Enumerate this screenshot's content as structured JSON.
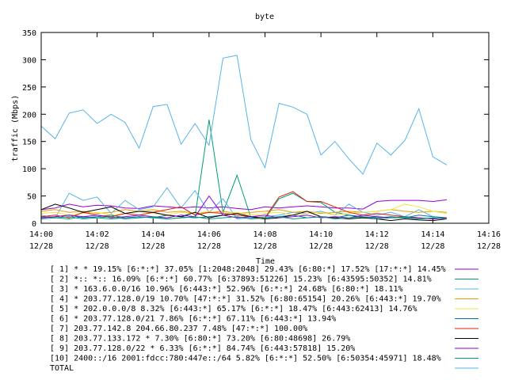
{
  "chart_data": {
    "type": "line",
    "title": "byte",
    "xlabel": "Time",
    "ylabel": "traffic (Mbps)",
    "ylim": [
      0,
      350
    ],
    "yticks": [
      "0",
      "50",
      "100",
      "150",
      "200",
      "250",
      "300",
      "350"
    ],
    "xlim": [
      "12/28 14:00",
      "12/28 14:16"
    ],
    "xticks": [
      {
        "time": "14:00",
        "date": "12/28"
      },
      {
        "time": "14:02",
        "date": "12/28"
      },
      {
        "time": "14:04",
        "date": "12/28"
      },
      {
        "time": "14:06",
        "date": "12/28"
      },
      {
        "time": "14:08",
        "date": "12/28"
      },
      {
        "time": "14:10",
        "date": "12/28"
      },
      {
        "time": "14:12",
        "date": "12/28"
      },
      {
        "time": "14:14",
        "date": "12/28"
      },
      {
        "time": "14:16",
        "date": "12/28"
      }
    ],
    "x_minutes": [
      0,
      0.5,
      1,
      1.5,
      2,
      2.5,
      3,
      3.5,
      4,
      4.5,
      5,
      5.5,
      6,
      6.5,
      7,
      7.5,
      8,
      8.5,
      9,
      9.5,
      10,
      10.5,
      11,
      11.5,
      12,
      12.5,
      13,
      13.5,
      14,
      14.5
    ],
    "grid": false,
    "legend_position": "bottom",
    "series": [
      {
        "legend": "[ 1] * * 19.15%  [6:*:*] 37.05% [1:2048:2048] 29.43% [6:80:*] 17.52% [17:*:*] 14.45%",
        "color": "#9400d3",
        "values": [
          25,
          28,
          35,
          30,
          33,
          32,
          28,
          27,
          32,
          30,
          28,
          30,
          28,
          30,
          27,
          25,
          30,
          28,
          30,
          32,
          30,
          28,
          28,
          26,
          40,
          42,
          42,
          42,
          40,
          43
        ]
      },
      {
        "legend": "[ 2] *:: *:: 16.09%  [6:*:*] 60.77% [6:37893:51226] 15.23% [6:43595:50352] 14.81%",
        "color": "#009e73",
        "values": [
          12,
          10,
          8,
          12,
          10,
          8,
          10,
          12,
          10,
          8,
          10,
          12,
          190,
          20,
          88,
          10,
          8,
          45,
          55,
          40,
          38,
          20,
          15,
          10,
          12,
          10,
          10,
          8,
          9,
          10
        ]
      },
      {
        "legend": "[ 3] * 163.6.0.0/16 10.96%  [6:443:*] 52.96% [6:*:*] 24.68% [6:80:*] 18.11%",
        "color": "#56b4e9",
        "values": [
          15,
          10,
          55,
          42,
          48,
          18,
          42,
          25,
          30,
          65,
          28,
          60,
          20,
          45,
          8,
          10,
          12,
          15,
          20,
          18,
          22,
          15,
          35,
          20,
          15,
          20,
          12,
          25,
          12,
          10
        ]
      },
      {
        "legend": "[ 4] * 203.77.128.0/19 10.70%  [47:*:*] 31.52% [6:80:65154] 20.26% [6:443:*] 19.70%",
        "color": "#e69f00",
        "values": [
          22,
          25,
          20,
          22,
          18,
          20,
          25,
          22,
          25,
          20,
          22,
          18,
          20,
          22,
          18,
          20,
          22,
          25,
          20,
          22,
          18,
          20,
          22,
          20,
          22,
          25,
          22,
          20,
          22,
          20
        ]
      },
      {
        "legend": "[ 5] * 202.0.0.0/8 8.32%  [6:443:*] 65.17% [6:*:*] 18.47% [6:443:62413] 14.76%",
        "color": "#f0e442",
        "values": [
          18,
          20,
          15,
          18,
          20,
          15,
          18,
          22,
          18,
          15,
          20,
          18,
          22,
          18,
          20,
          15,
          18,
          20,
          15,
          18,
          20,
          15,
          18,
          20,
          22,
          25,
          35,
          30,
          22,
          18
        ]
      },
      {
        "legend": "[ 6] * 203.77.128.0/21 7.86%  [6:*:*] 67.11% [6:443:*] 13.94%",
        "color": "#0072b2",
        "values": [
          10,
          12,
          15,
          10,
          12,
          15,
          10,
          12,
          10,
          15,
          12,
          10,
          12,
          15,
          10,
          12,
          10,
          12,
          15,
          10,
          12,
          10,
          15,
          12,
          10,
          12,
          10,
          15,
          12,
          10
        ]
      },
      {
        "legend": "[ 7] 203.77.142.8 204.66.80.237 7.48%  [47:*:*] 100.00%",
        "color": "#e51e10",
        "values": [
          12,
          15,
          10,
          20,
          15,
          12,
          18,
          15,
          20,
          25,
          30,
          15,
          20,
          18,
          15,
          12,
          10,
          48,
          58,
          40,
          40,
          30,
          20,
          15,
          18,
          15,
          12,
          10,
          8,
          10
        ]
      },
      {
        "legend": "[ 8] 203.77.133.172 * 7.30%  [6:80:*] 73.20% [6:80:48698] 26.79%",
        "color": "#000000",
        "values": [
          25,
          35,
          28,
          20,
          25,
          30,
          18,
          22,
          20,
          15,
          12,
          20,
          10,
          15,
          18,
          12,
          8,
          10,
          15,
          22,
          12,
          10,
          8,
          10,
          8,
          5,
          8,
          6,
          5,
          8
        ]
      },
      {
        "legend": "[ 9] 203.77.128.0/22 * 6.33%  [6:*:*] 84.74% [6:443:57818] 15.20%",
        "color": "#9400d3",
        "values": [
          10,
          12,
          15,
          12,
          15,
          10,
          12,
          15,
          12,
          10,
          15,
          12,
          50,
          15,
          10,
          12,
          15,
          10,
          12,
          15,
          10,
          12,
          10,
          15,
          12,
          10,
          12,
          10,
          8,
          10
        ]
      },
      {
        "legend": "[10] 2400::/16 2001:fdcc:780:447e::/64 5.82%  [6:*:*] 52.50% [6:50354:45971] 18.48%",
        "color": "#009e73",
        "values": [
          8,
          10,
          12,
          8,
          10,
          12,
          8,
          10,
          12,
          8,
          10,
          12,
          8,
          10,
          12,
          8,
          10,
          12,
          8,
          10,
          12,
          8,
          10,
          12,
          8,
          10,
          12,
          8,
          10,
          8
        ]
      },
      {
        "legend": "TOTAL",
        "color": "#56b4e9",
        "values": [
          178,
          155,
          202,
          208,
          183,
          200,
          185,
          138,
          214,
          218,
          145,
          183,
          143,
          303,
          308,
          153,
          102,
          220,
          213,
          200,
          125,
          150,
          118,
          90,
          147,
          125,
          152,
          210,
          122,
          107
        ]
      }
    ]
  }
}
